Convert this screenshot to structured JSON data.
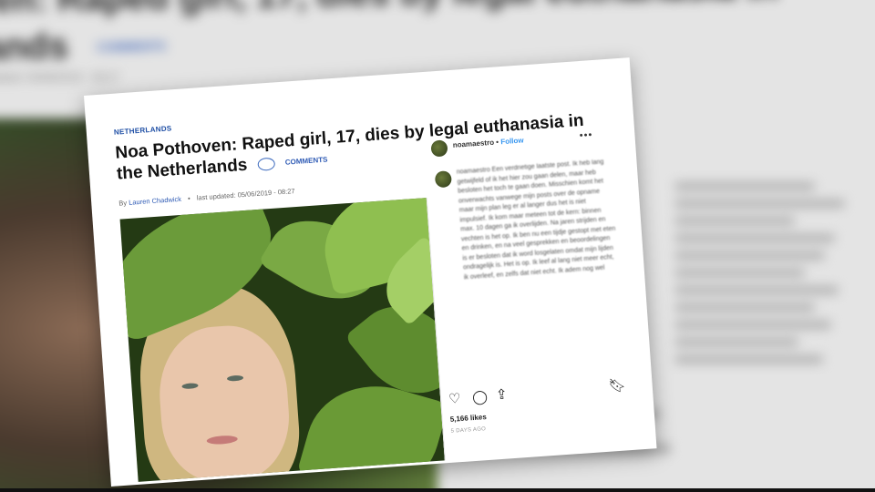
{
  "background": {
    "headline_line1": "ven: Raped girl, 17, dies by legal euthanasia in",
    "headline_line2": "lands",
    "comments_label": "COMMENTS",
    "updated": "updated: 05/06/2019 - 08:27"
  },
  "article": {
    "section": "NETHERLANDS",
    "title_line1": "Noa Pothoven: Raped girl, 17, dies by legal euthanasia in",
    "title_line2": "the Netherlands",
    "comments_label": "COMMENTS",
    "byline_prefix": "By",
    "author": "Lauren Chadwick",
    "updated": "last updated: 05/06/2019 - 08:27"
  },
  "instagram": {
    "username": "noamaestro",
    "follow_label": "Follow",
    "caption": "noamaestro Een verdrietige laatste post. Ik heb lang getwijfeld of ik het hier zou gaan delen, maar heb besloten het toch te gaan doen. Misschien komt het onverwachts vanwege mijn posts over de opname maar mijn plan leg er al langer dus het is niet impulsief. Ik kom maar meteen tot de kern: binnen max. 10 dagen ga ik overlijden. Na jaren strijden en vechten is het op. Ik ben nu een tijdje gestopt met eten en drinken, en na veel gesprekken en beoordelingen is er besloten dat ik word losgelaten omdat mijn lijden ondragelijk is. Het is op. Ik leef al lang niet meer echt, ik overleef, en zelfs dat niet echt. Ik adem nog wel",
    "likes": "5,166 likes",
    "time_ago": "5 DAYS AGO",
    "icons": [
      "heart-icon",
      "comment-icon",
      "share-icon",
      "bookmark-icon"
    ]
  }
}
